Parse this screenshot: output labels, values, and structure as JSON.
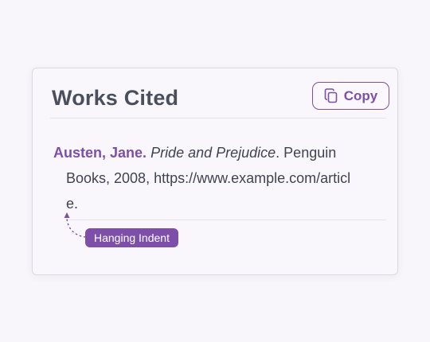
{
  "card": {
    "title": "Works Cited",
    "copy_button": {
      "label": "Copy",
      "icon": "copy-icon"
    }
  },
  "citation": {
    "author": "Austen, Jane.",
    "book_title": "Pride and Prejudice",
    "publisher_line1": ". Penguin",
    "line2": "Books, 2008, https://www.example.com/articl",
    "line3": "e."
  },
  "annotation": {
    "label": "Hanging Indent",
    "icon": "arrow-up-icon"
  },
  "colors": {
    "accent": "#7d4fa8",
    "text": "#3f4452",
    "heading": "#4a4f5e",
    "background": "#f8f6fa"
  }
}
